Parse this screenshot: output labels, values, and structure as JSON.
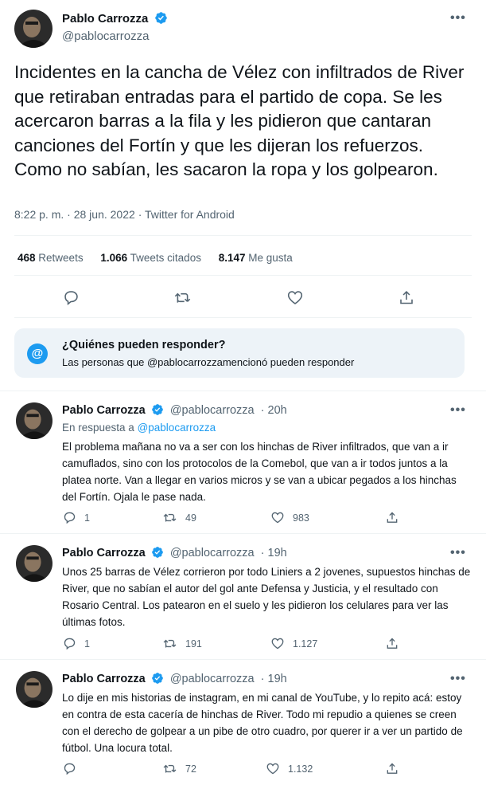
{
  "main_tweet": {
    "author_name": "Pablo Carrozza",
    "author_handle": "@pablocarrozza",
    "text": "Incidentes en la cancha de Vélez con infiltrados de River que retiraban entradas para el partido de copa. Se les acercaron barras a la fila y les pidieron que cantaran canciones del Fortín y que les dijeran los refuerzos. Como no sabían, les sacaron la ropa y los golpearon.",
    "time": "8:22 p. m.",
    "date": "28 jun. 2022",
    "source": "Twitter for Android",
    "separator": "·",
    "retweets_count": "468",
    "retweets_label": "Retweets",
    "quotes_count": "1.066",
    "quotes_label": "Tweets citados",
    "likes_count": "8.147",
    "likes_label": "Me gusta"
  },
  "who_can_reply": {
    "icon": "@",
    "title": "¿Quiénes pueden responder?",
    "subtitle": "Las personas que @pablocarrozzamencionó pueden responder"
  },
  "replies": [
    {
      "author_name": "Pablo Carrozza",
      "author_handle": "@pablocarrozza",
      "time": "· 20h",
      "reply_to_prefix": "En respuesta a",
      "reply_to_mention": "@pablocarrozza",
      "text": "El problema mañana no va a ser con los hinchas de River infiltrados, que van a ir camuflados, sino con los protocolos de la Comebol, que van a ir todos juntos a la platea norte. Van a llegar en varios micros y se van a ubicar pegados a los hinchas del Fortín. Ojala le pase nada.",
      "reply_count": "1",
      "retweet_count": "49",
      "like_count": "983"
    },
    {
      "author_name": "Pablo Carrozza",
      "author_handle": "@pablocarrozza",
      "time": "· 19h",
      "text": "Unos 25 barras de Vélez corrieron por todo Liniers a 2 jovenes, supuestos hinchas de River, que no sabían el autor del gol ante Defensa y Justicia, y el resultado con Rosario Central. Los patearon en el suelo y les pidieron los celulares para ver las últimas fotos.",
      "reply_count": "1",
      "retweet_count": "191",
      "like_count": "1.127"
    },
    {
      "author_name": "Pablo Carrozza",
      "author_handle": "@pablocarrozza",
      "time": "· 19h",
      "text": "Lo dije en mis historias de instagram, en mi canal de YouTube, y lo repito acá: estoy en contra de esta cacería de hinchas de River. Todo mi repudio a quienes se creen con el derecho de golpear a un pibe de otro cuadro, por querer ir a ver un partido de fútbol. Una locura total.",
      "reply_count": "",
      "retweet_count": "72",
      "like_count": "1.132"
    }
  ],
  "colors": {
    "accent": "#1d9bf0",
    "text": "#0f1419",
    "secondary": "#536471",
    "divider": "#eff3f4",
    "notice_bg": "#edf3f8"
  }
}
